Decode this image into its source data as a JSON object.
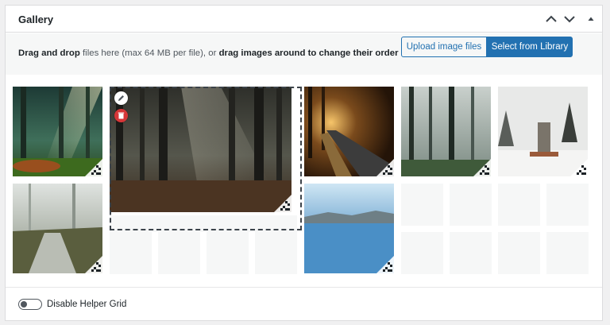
{
  "panel": {
    "title": "Gallery",
    "header_buttons": [
      {
        "icon": "chevron-up-icon"
      },
      {
        "icon": "chevron-down-icon"
      },
      {
        "icon": "triangle-up-icon"
      }
    ]
  },
  "toolbar": {
    "drag_text_bold_1": "Drag and drop",
    "drag_text_plain_1": " files here (max 64 MB per file), or ",
    "drag_text_bold_2": "drag images around to change their order",
    "upload_label": "Upload image files",
    "library_label": "Select from Library"
  },
  "gallery": {
    "images": [
      {
        "name": "forest-sunbeams-thumb",
        "scene": "forest sunbeams"
      },
      {
        "name": "dark-forest-large-thumb",
        "scene": "dark misty forest"
      },
      {
        "name": "autumn-road-thumb",
        "scene": "autumn road"
      },
      {
        "name": "misty-trees-thumb",
        "scene": "misty trees"
      },
      {
        "name": "winter-monument-thumb",
        "scene": "winter monument"
      },
      {
        "name": "frosty-path-thumb",
        "scene": "frosty path"
      },
      {
        "name": "lake-blue-thumb",
        "scene": "blue lake"
      }
    ],
    "controls": {
      "edit_icon": "pencil-icon",
      "delete_icon": "trash-icon"
    }
  },
  "footer": {
    "toggle_label": "Disable Helper Grid",
    "toggle_on": false
  },
  "colors": {
    "accent": "#2271b1",
    "delete": "#d63638"
  }
}
